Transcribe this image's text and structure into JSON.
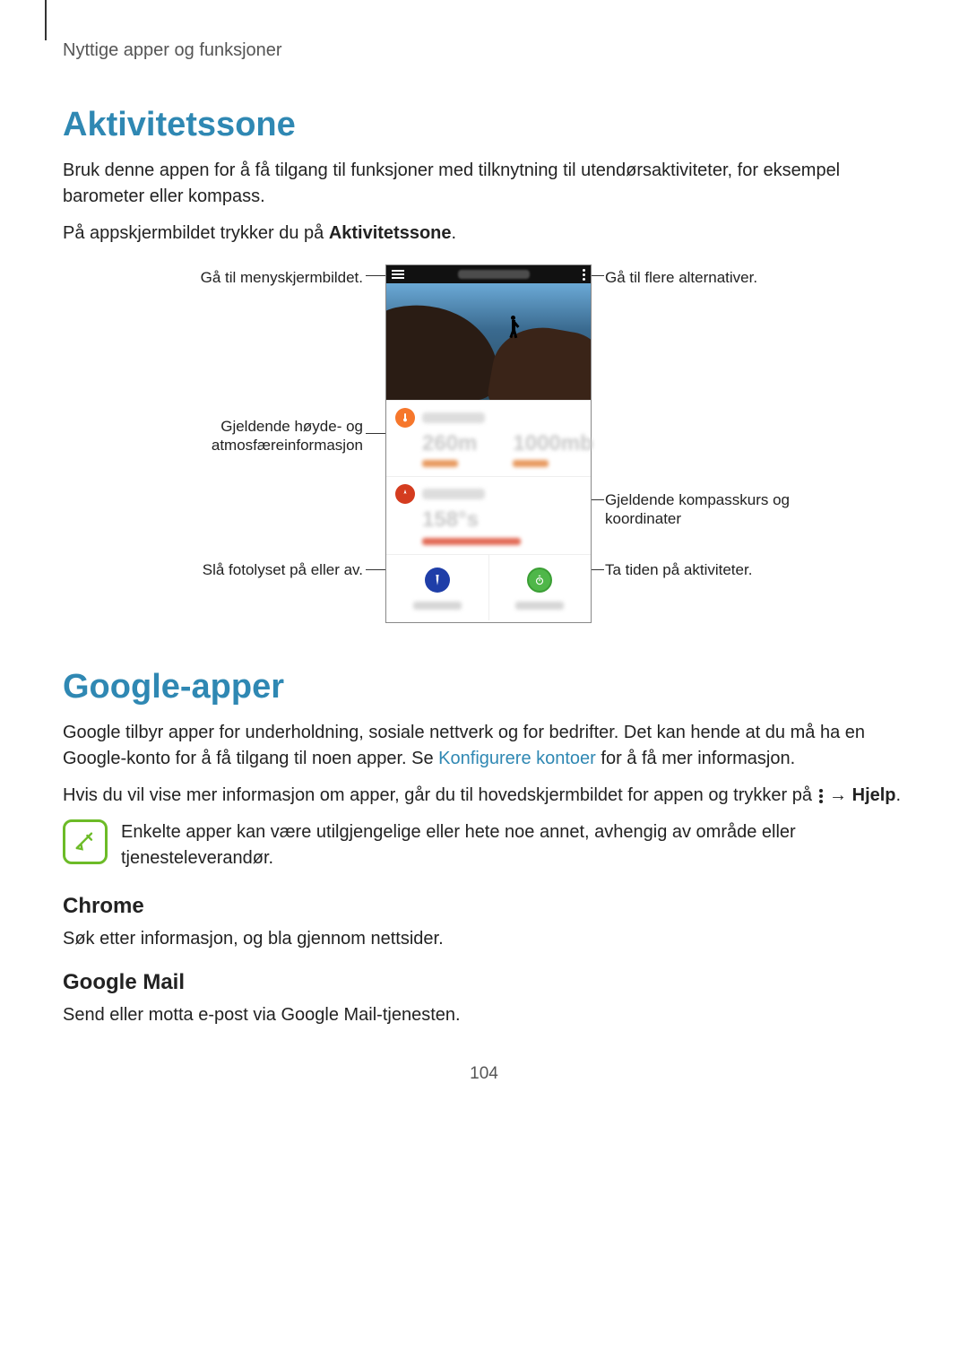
{
  "header": {
    "breadcrumb": "Nyttige apper og funksjoner"
  },
  "section1": {
    "title": "Aktivitetssone",
    "p1": "Bruk denne appen for å få tilgang til funksjoner med tilknytning til utendørsaktiviteter, for eksempel barometer eller kompass.",
    "p2_a": "På appskjermbildet trykker du på ",
    "p2_b": "Aktivitetssone",
    "p2_c": "."
  },
  "figure": {
    "callouts": {
      "menu": "Gå til menyskjermbildet.",
      "altitude": "Gjeldende høyde- og atmosfæreinformasjon",
      "flash": "Slå fotolyset på eller av.",
      "more": "Gå til flere alternativer.",
      "compass": "Gjeldende kompasskurs og koordinater",
      "timer": "Ta tiden på aktiviteter."
    },
    "blurred_values": {
      "altitude_value": "260m",
      "pressure_value": "1000mb",
      "compass_value": "158°s"
    }
  },
  "section2": {
    "title": "Google-apper",
    "p1_a": "Google tilbyr apper for underholdning, sosiale nettverk og for bedrifter. Det kan hende at du må ha en Google-konto for å få tilgang til noen apper. Se ",
    "p1_link": "Konfigurere kontoer",
    "p1_b": " for å få mer informasjon.",
    "p2_a": "Hvis du vil vise mer informasjon om apper, går du til hovedskjermbildet for appen og trykker på ",
    "p2_b": " → ",
    "p2_c": "Hjelp",
    "p2_d": ".",
    "note": "Enkelte apper kan være utilgjengelige eller hete noe annet, avhengig av område eller tjenesteleverandør.",
    "chrome_h": "Chrome",
    "chrome_p": "Søk etter informasjon, og bla gjennom nettsider.",
    "gmail_h": "Google Mail",
    "gmail_p": "Send eller motta e-post via Google Mail-tjenesten."
  },
  "page_number": "104"
}
